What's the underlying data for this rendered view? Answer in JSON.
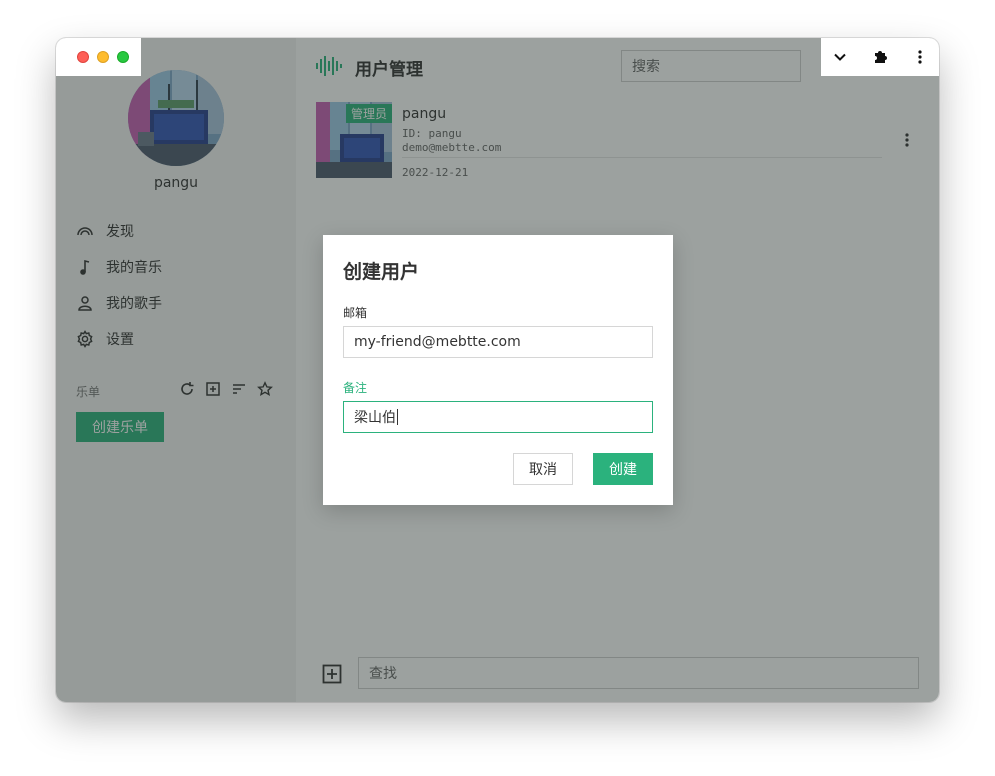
{
  "sidebar": {
    "username": "pangu",
    "nav": [
      {
        "label": "发现",
        "icon": "rainbow-icon"
      },
      {
        "label": "我的音乐",
        "icon": "music-note-icon"
      },
      {
        "label": "我的歌手",
        "icon": "person-icon"
      },
      {
        "label": "设置",
        "icon": "gear-icon"
      }
    ],
    "playlist_label": "乐单",
    "create_playlist_label": "创建乐单"
  },
  "header": {
    "title": "用户管理",
    "search_placeholder": "搜索"
  },
  "user": {
    "name": "pangu",
    "badge": "管理员",
    "id_line": "ID: pangu",
    "email": "demo@mebtte.com",
    "date": "2022-12-21"
  },
  "bottom": {
    "find_placeholder": "查找"
  },
  "dialog": {
    "title": "创建用户",
    "email_label": "邮箱",
    "email_value": "my-friend@mebtte.com",
    "remark_label": "备注",
    "remark_value": "梁山伯",
    "cancel_label": "取消",
    "create_label": "创建"
  },
  "colors": {
    "accent": "#2bb27d",
    "overlay": "#28322d"
  }
}
